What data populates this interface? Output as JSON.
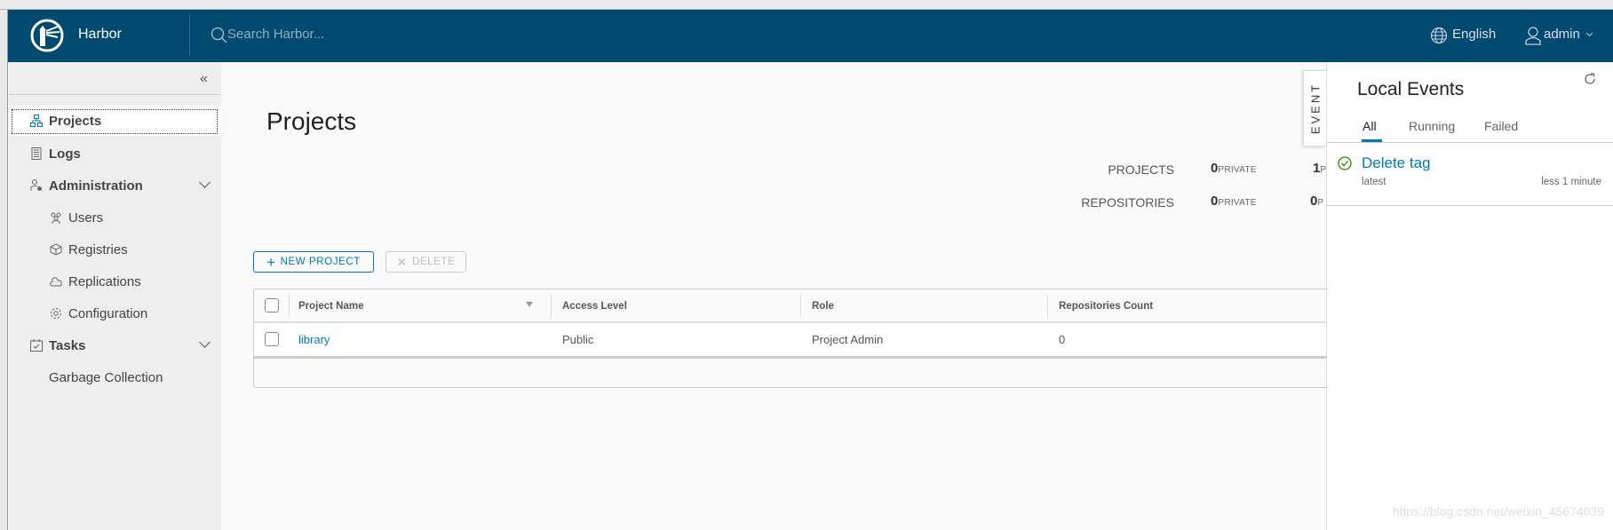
{
  "header": {
    "app_name": "Harbor",
    "search_placeholder": "Search Harbor...",
    "language": "English",
    "user": "admin",
    "bg_color": "#004a70"
  },
  "sidebar": {
    "items": [
      {
        "label": "Projects",
        "icon": "projects-icon",
        "active": true
      },
      {
        "label": "Logs",
        "icon": "logs-icon"
      },
      {
        "label": "Administration",
        "icon": "administration-icon",
        "expanded": true
      },
      {
        "label": "Users",
        "icon": "users-icon"
      },
      {
        "label": "Registries",
        "icon": "registries-icon"
      },
      {
        "label": "Replications",
        "icon": "replications-icon"
      },
      {
        "label": "Configuration",
        "icon": "gear-icon"
      },
      {
        "label": "Tasks",
        "icon": "tasks-icon",
        "expanded": true
      },
      {
        "label": "Garbage Collection"
      }
    ]
  },
  "main": {
    "title": "Projects",
    "stats": {
      "projects_label": "PROJECTS",
      "projects_private": "0",
      "projects_public": "1",
      "repositories_label": "REPOSITORIES",
      "repositories_private": "0",
      "repositories_public": "0",
      "private_label": "PRIVATE",
      "public_label_clipped": "P"
    },
    "new_project_label": "NEW PROJECT",
    "delete_label": "DELETE",
    "table": {
      "columns": [
        "Project Name",
        "Access Level",
        "Role",
        "Repositories Count"
      ],
      "rows": [
        {
          "name": "library",
          "access": "Public",
          "role": "Project Admin",
          "repos": "0"
        }
      ]
    }
  },
  "event_tab": "EVENT",
  "events": {
    "title": "Local Events",
    "tabs": [
      "All",
      "Running",
      "Failed"
    ],
    "active_tab": "All",
    "items": [
      {
        "title": "Delete tag",
        "subtitle": "latest",
        "time": "less 1 minute",
        "status": "success"
      }
    ]
  },
  "accent_color": "#0079b8",
  "watermark": "https://blog.csdn.net/weixin_45674039"
}
